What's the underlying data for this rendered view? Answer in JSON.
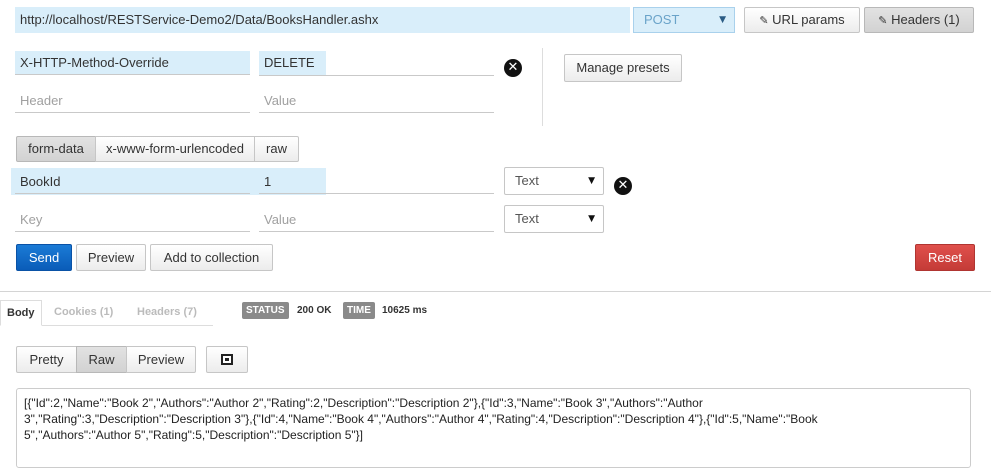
{
  "request": {
    "url": "http://localhost/RESTService-Demo2/Data/BooksHandler.ashx",
    "method": "POST",
    "url_params_label": "URL params",
    "headers_label": "Headers (1)"
  },
  "headers": {
    "rows": [
      {
        "key": "X-HTTP-Method-Override",
        "value": "DELETE"
      }
    ],
    "key_placeholder": "Header",
    "value_placeholder": "Value",
    "manage_presets_label": "Manage presets"
  },
  "body_tabs": [
    "form-data",
    "x-www-form-urlencoded",
    "raw"
  ],
  "form": {
    "rows": [
      {
        "key": "BookId",
        "value": "1",
        "type": "Text"
      }
    ],
    "key_placeholder": "Key",
    "value_placeholder": "Value",
    "new_type": "Text"
  },
  "actions": {
    "send": "Send",
    "preview": "Preview",
    "add_to_collection": "Add to collection",
    "reset": "Reset"
  },
  "response": {
    "tabs": [
      "Body",
      "Cookies (1)",
      "Headers (7)"
    ],
    "status_label": "STATUS",
    "status_value": "200 OK",
    "time_label": "TIME",
    "time_value": "10625 ms",
    "view_modes": [
      "Pretty",
      "Raw",
      "Preview"
    ],
    "body_lines": [
      "[{\"Id\":2,\"Name\":\"Book 2\",\"Authors\":\"Author 2\",\"Rating\":2,\"Description\":\"Description 2\"},{\"Id\":3,\"Name\":\"Book 3\",\"Authors\":\"Author",
      "3\",\"Rating\":3,\"Description\":\"Description 3\"},{\"Id\":4,\"Name\":\"Book 4\",\"Authors\":\"Author 4\",\"Rating\":4,\"Description\":\"Description 4\"},{\"Id\":5,\"Name\":\"Book",
      "5\",\"Authors\":\"Author 5\",\"Rating\":5,\"Description\":\"Description 5\"}]"
    ]
  },
  "colors": {
    "accent_blue": "#0a5cb8",
    "danger_red": "#c43b37",
    "highlight": "#d9eefa"
  }
}
